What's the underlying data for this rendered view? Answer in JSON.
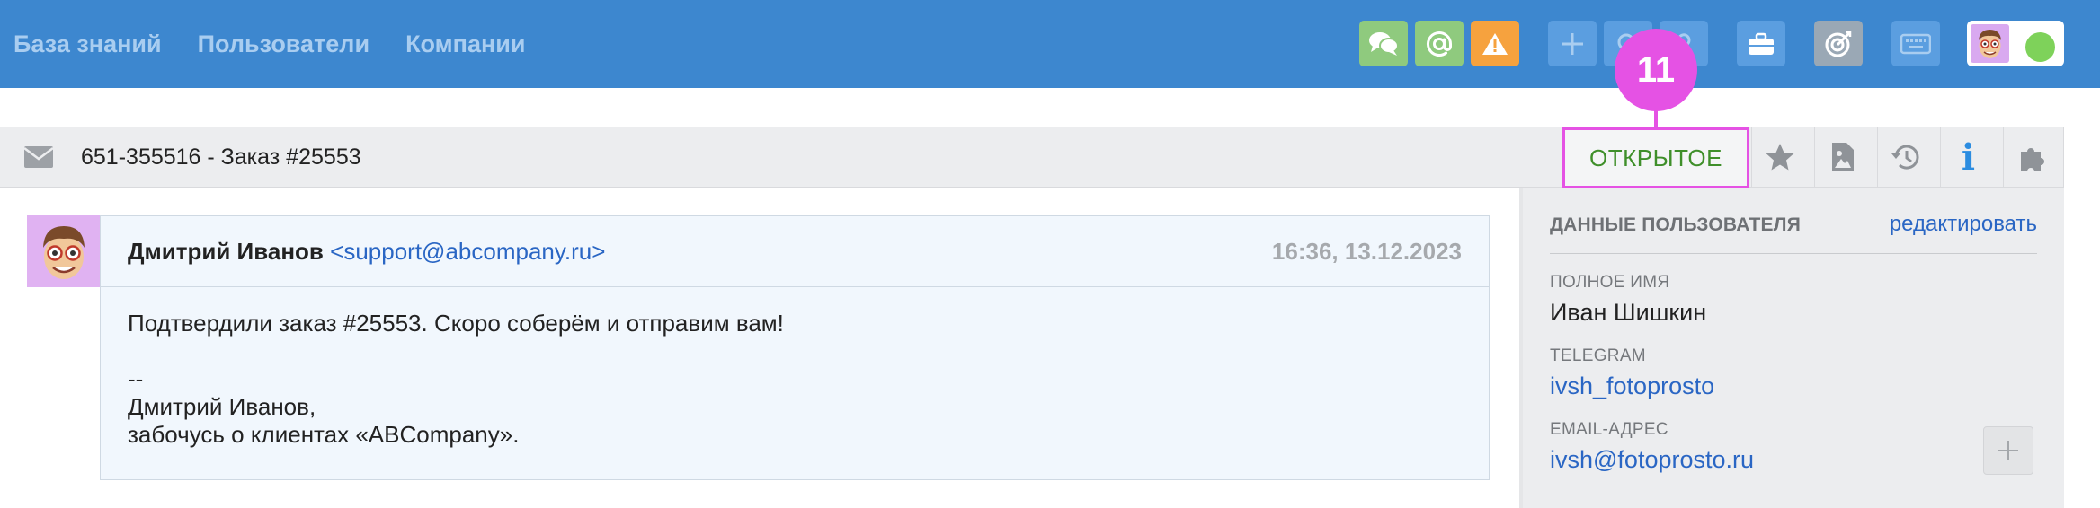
{
  "nav": {
    "items": [
      "База знаний",
      "Пользователи",
      "Компании"
    ]
  },
  "toolbar": {
    "icons": [
      "chat-icon",
      "at-icon",
      "warning-icon",
      "plus-icon",
      "search-icon",
      "help-icon",
      "briefcase-icon",
      "target-icon",
      "keyboard-icon"
    ],
    "status_color": "#7ed25a"
  },
  "ticket": {
    "title": "651-355516 - Заказ #25553",
    "status": "ОТКРЫТОЕ",
    "status_color": "#3f8f2a"
  },
  "callout": {
    "number": "11",
    "color": "#e552e4"
  },
  "message": {
    "sender_name": "Дмитрий Иванов",
    "sender_email": "<support@abcompany.ru>",
    "time": "16:36, 13.12.2023",
    "body": [
      "Подтвердили заказ #25553. Скоро соберём и отправим вам!",
      "",
      "--",
      "Дмитрий Иванов,",
      "забочусь о клиентах «ABCompany»."
    ]
  },
  "user_panel": {
    "title": "ДАННЫЕ ПОЛЬЗОВАТЕЛЯ",
    "edit_label": "редактировать",
    "fields": [
      {
        "label": "ПОЛНОЕ ИМЯ",
        "value": "Иван Шишкин"
      },
      {
        "label": "TELEGRAM",
        "value": "ivsh_fotoprosto"
      },
      {
        "label": "EMAIL-АДРЕС",
        "value": "ivsh@fotoprosto.ru"
      }
    ]
  }
}
